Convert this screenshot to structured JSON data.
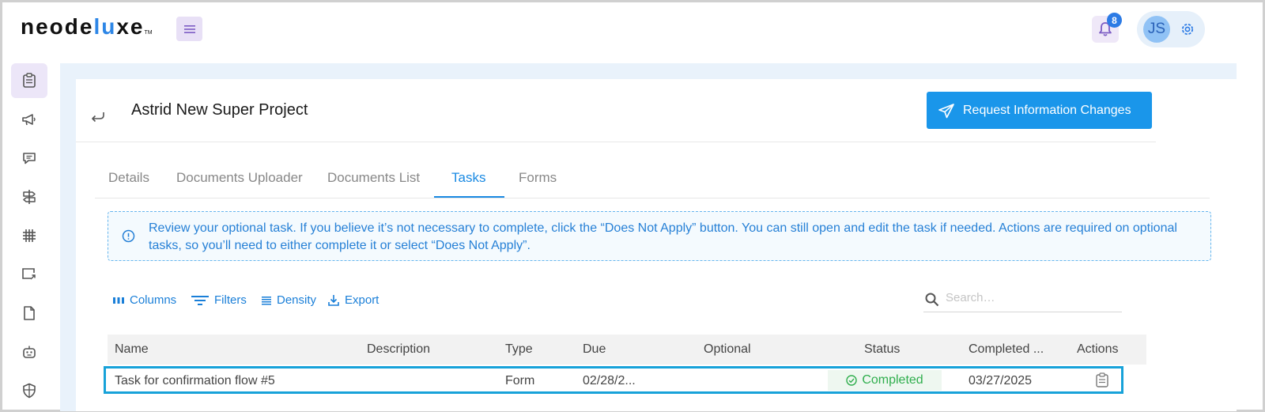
{
  "header": {
    "logo": {
      "part1": "neode",
      "part2": "lu",
      "part3": "xe",
      "tm": "TM"
    },
    "notifications_count": "8",
    "user_initials": "JS"
  },
  "sidebar": {
    "items": [
      {
        "icon": "clipboard-icon",
        "active": true
      },
      {
        "icon": "megaphone-icon"
      },
      {
        "icon": "chat-icon"
      },
      {
        "icon": "signpost-icon"
      },
      {
        "icon": "grid-icon"
      },
      {
        "icon": "share-screen-icon"
      },
      {
        "icon": "document-icon"
      },
      {
        "icon": "robot-icon"
      },
      {
        "icon": "shield-icon"
      }
    ]
  },
  "project": {
    "title": "Astrid New Super Project",
    "request_button": "Request Information Changes"
  },
  "tabs": [
    {
      "label": "Details"
    },
    {
      "label": "Documents Uploader"
    },
    {
      "label": "Documents List"
    },
    {
      "label": "Tasks",
      "active": true
    },
    {
      "label": "Forms"
    }
  ],
  "alert": {
    "text": "Review your optional task. If you believe it’s not necessary to complete, click the “Does Not Apply” button. You can still open and edit the task if needed. Actions are required on optional tasks, so you’ll need to either complete it or select “Does Not Apply”."
  },
  "toolbar": {
    "columns": "Columns",
    "filters": "Filters",
    "density": "Density",
    "export": "Export",
    "search_placeholder": "Search…"
  },
  "table": {
    "headers": [
      "Name",
      "Description",
      "Type",
      "Due",
      "Optional",
      "Status",
      "Completed ...",
      "Actions"
    ],
    "rows": [
      {
        "name": "Task for confirmation flow #5",
        "description": "",
        "type": "Form",
        "due": "02/28/2...",
        "optional": "",
        "status": "Completed",
        "completed": "03/27/2025"
      }
    ]
  },
  "colors": {
    "accent": "#1a96ea",
    "status_completed": "#2fae4d",
    "sidebar_active_bg": "#ece6f8",
    "content_bg": "#e9f2fb"
  }
}
